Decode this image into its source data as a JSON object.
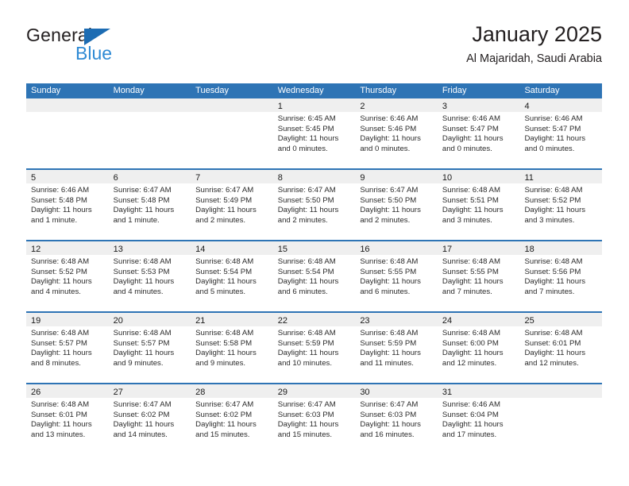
{
  "brand": {
    "name_part1": "General",
    "name_part2": "Blue",
    "triangle_color": "#1c6cb3",
    "blue_text_color": "#2e8ad4"
  },
  "header": {
    "title": "January 2025",
    "subtitle": "Al Majaridah, Saudi Arabia"
  },
  "theme": {
    "header_blue": "#2e74b5",
    "day_band_gray": "#efefef",
    "cell_white": "#ffffff",
    "text_dark": "#231f20"
  },
  "weekday_headers": [
    "Sunday",
    "Monday",
    "Tuesday",
    "Wednesday",
    "Thursday",
    "Friday",
    "Saturday"
  ],
  "weeks": [
    [
      {
        "day": "",
        "sunrise": "",
        "sunset": "",
        "daylight_line1": "",
        "daylight_line2": "",
        "empty": true
      },
      {
        "day": "",
        "sunrise": "",
        "sunset": "",
        "daylight_line1": "",
        "daylight_line2": "",
        "empty": true
      },
      {
        "day": "",
        "sunrise": "",
        "sunset": "",
        "daylight_line1": "",
        "daylight_line2": "",
        "empty": true
      },
      {
        "day": "1",
        "sunrise": "Sunrise: 6:45 AM",
        "sunset": "Sunset: 5:45 PM",
        "daylight_line1": "Daylight: 11 hours",
        "daylight_line2": "and 0 minutes."
      },
      {
        "day": "2",
        "sunrise": "Sunrise: 6:46 AM",
        "sunset": "Sunset: 5:46 PM",
        "daylight_line1": "Daylight: 11 hours",
        "daylight_line2": "and 0 minutes."
      },
      {
        "day": "3",
        "sunrise": "Sunrise: 6:46 AM",
        "sunset": "Sunset: 5:47 PM",
        "daylight_line1": "Daylight: 11 hours",
        "daylight_line2": "and 0 minutes."
      },
      {
        "day": "4",
        "sunrise": "Sunrise: 6:46 AM",
        "sunset": "Sunset: 5:47 PM",
        "daylight_line1": "Daylight: 11 hours",
        "daylight_line2": "and 0 minutes."
      }
    ],
    [
      {
        "day": "5",
        "sunrise": "Sunrise: 6:46 AM",
        "sunset": "Sunset: 5:48 PM",
        "daylight_line1": "Daylight: 11 hours",
        "daylight_line2": "and 1 minute."
      },
      {
        "day": "6",
        "sunrise": "Sunrise: 6:47 AM",
        "sunset": "Sunset: 5:48 PM",
        "daylight_line1": "Daylight: 11 hours",
        "daylight_line2": "and 1 minute."
      },
      {
        "day": "7",
        "sunrise": "Sunrise: 6:47 AM",
        "sunset": "Sunset: 5:49 PM",
        "daylight_line1": "Daylight: 11 hours",
        "daylight_line2": "and 2 minutes."
      },
      {
        "day": "8",
        "sunrise": "Sunrise: 6:47 AM",
        "sunset": "Sunset: 5:50 PM",
        "daylight_line1": "Daylight: 11 hours",
        "daylight_line2": "and 2 minutes."
      },
      {
        "day": "9",
        "sunrise": "Sunrise: 6:47 AM",
        "sunset": "Sunset: 5:50 PM",
        "daylight_line1": "Daylight: 11 hours",
        "daylight_line2": "and 2 minutes."
      },
      {
        "day": "10",
        "sunrise": "Sunrise: 6:48 AM",
        "sunset": "Sunset: 5:51 PM",
        "daylight_line1": "Daylight: 11 hours",
        "daylight_line2": "and 3 minutes."
      },
      {
        "day": "11",
        "sunrise": "Sunrise: 6:48 AM",
        "sunset": "Sunset: 5:52 PM",
        "daylight_line1": "Daylight: 11 hours",
        "daylight_line2": "and 3 minutes."
      }
    ],
    [
      {
        "day": "12",
        "sunrise": "Sunrise: 6:48 AM",
        "sunset": "Sunset: 5:52 PM",
        "daylight_line1": "Daylight: 11 hours",
        "daylight_line2": "and 4 minutes."
      },
      {
        "day": "13",
        "sunrise": "Sunrise: 6:48 AM",
        "sunset": "Sunset: 5:53 PM",
        "daylight_line1": "Daylight: 11 hours",
        "daylight_line2": "and 4 minutes."
      },
      {
        "day": "14",
        "sunrise": "Sunrise: 6:48 AM",
        "sunset": "Sunset: 5:54 PM",
        "daylight_line1": "Daylight: 11 hours",
        "daylight_line2": "and 5 minutes."
      },
      {
        "day": "15",
        "sunrise": "Sunrise: 6:48 AM",
        "sunset": "Sunset: 5:54 PM",
        "daylight_line1": "Daylight: 11 hours",
        "daylight_line2": "and 6 minutes."
      },
      {
        "day": "16",
        "sunrise": "Sunrise: 6:48 AM",
        "sunset": "Sunset: 5:55 PM",
        "daylight_line1": "Daylight: 11 hours",
        "daylight_line2": "and 6 minutes."
      },
      {
        "day": "17",
        "sunrise": "Sunrise: 6:48 AM",
        "sunset": "Sunset: 5:55 PM",
        "daylight_line1": "Daylight: 11 hours",
        "daylight_line2": "and 7 minutes."
      },
      {
        "day": "18",
        "sunrise": "Sunrise: 6:48 AM",
        "sunset": "Sunset: 5:56 PM",
        "daylight_line1": "Daylight: 11 hours",
        "daylight_line2": "and 7 minutes."
      }
    ],
    [
      {
        "day": "19",
        "sunrise": "Sunrise: 6:48 AM",
        "sunset": "Sunset: 5:57 PM",
        "daylight_line1": "Daylight: 11 hours",
        "daylight_line2": "and 8 minutes."
      },
      {
        "day": "20",
        "sunrise": "Sunrise: 6:48 AM",
        "sunset": "Sunset: 5:57 PM",
        "daylight_line1": "Daylight: 11 hours",
        "daylight_line2": "and 9 minutes."
      },
      {
        "day": "21",
        "sunrise": "Sunrise: 6:48 AM",
        "sunset": "Sunset: 5:58 PM",
        "daylight_line1": "Daylight: 11 hours",
        "daylight_line2": "and 9 minutes."
      },
      {
        "day": "22",
        "sunrise": "Sunrise: 6:48 AM",
        "sunset": "Sunset: 5:59 PM",
        "daylight_line1": "Daylight: 11 hours",
        "daylight_line2": "and 10 minutes."
      },
      {
        "day": "23",
        "sunrise": "Sunrise: 6:48 AM",
        "sunset": "Sunset: 5:59 PM",
        "daylight_line1": "Daylight: 11 hours",
        "daylight_line2": "and 11 minutes."
      },
      {
        "day": "24",
        "sunrise": "Sunrise: 6:48 AM",
        "sunset": "Sunset: 6:00 PM",
        "daylight_line1": "Daylight: 11 hours",
        "daylight_line2": "and 12 minutes."
      },
      {
        "day": "25",
        "sunrise": "Sunrise: 6:48 AM",
        "sunset": "Sunset: 6:01 PM",
        "daylight_line1": "Daylight: 11 hours",
        "daylight_line2": "and 12 minutes."
      }
    ],
    [
      {
        "day": "26",
        "sunrise": "Sunrise: 6:48 AM",
        "sunset": "Sunset: 6:01 PM",
        "daylight_line1": "Daylight: 11 hours",
        "daylight_line2": "and 13 minutes."
      },
      {
        "day": "27",
        "sunrise": "Sunrise: 6:47 AM",
        "sunset": "Sunset: 6:02 PM",
        "daylight_line1": "Daylight: 11 hours",
        "daylight_line2": "and 14 minutes."
      },
      {
        "day": "28",
        "sunrise": "Sunrise: 6:47 AM",
        "sunset": "Sunset: 6:02 PM",
        "daylight_line1": "Daylight: 11 hours",
        "daylight_line2": "and 15 minutes."
      },
      {
        "day": "29",
        "sunrise": "Sunrise: 6:47 AM",
        "sunset": "Sunset: 6:03 PM",
        "daylight_line1": "Daylight: 11 hours",
        "daylight_line2": "and 15 minutes."
      },
      {
        "day": "30",
        "sunrise": "Sunrise: 6:47 AM",
        "sunset": "Sunset: 6:03 PM",
        "daylight_line1": "Daylight: 11 hours",
        "daylight_line2": "and 16 minutes."
      },
      {
        "day": "31",
        "sunrise": "Sunrise: 6:46 AM",
        "sunset": "Sunset: 6:04 PM",
        "daylight_line1": "Daylight: 11 hours",
        "daylight_line2": "and 17 minutes."
      },
      {
        "day": "",
        "sunrise": "",
        "sunset": "",
        "daylight_line1": "",
        "daylight_line2": "",
        "empty": true
      }
    ]
  ]
}
